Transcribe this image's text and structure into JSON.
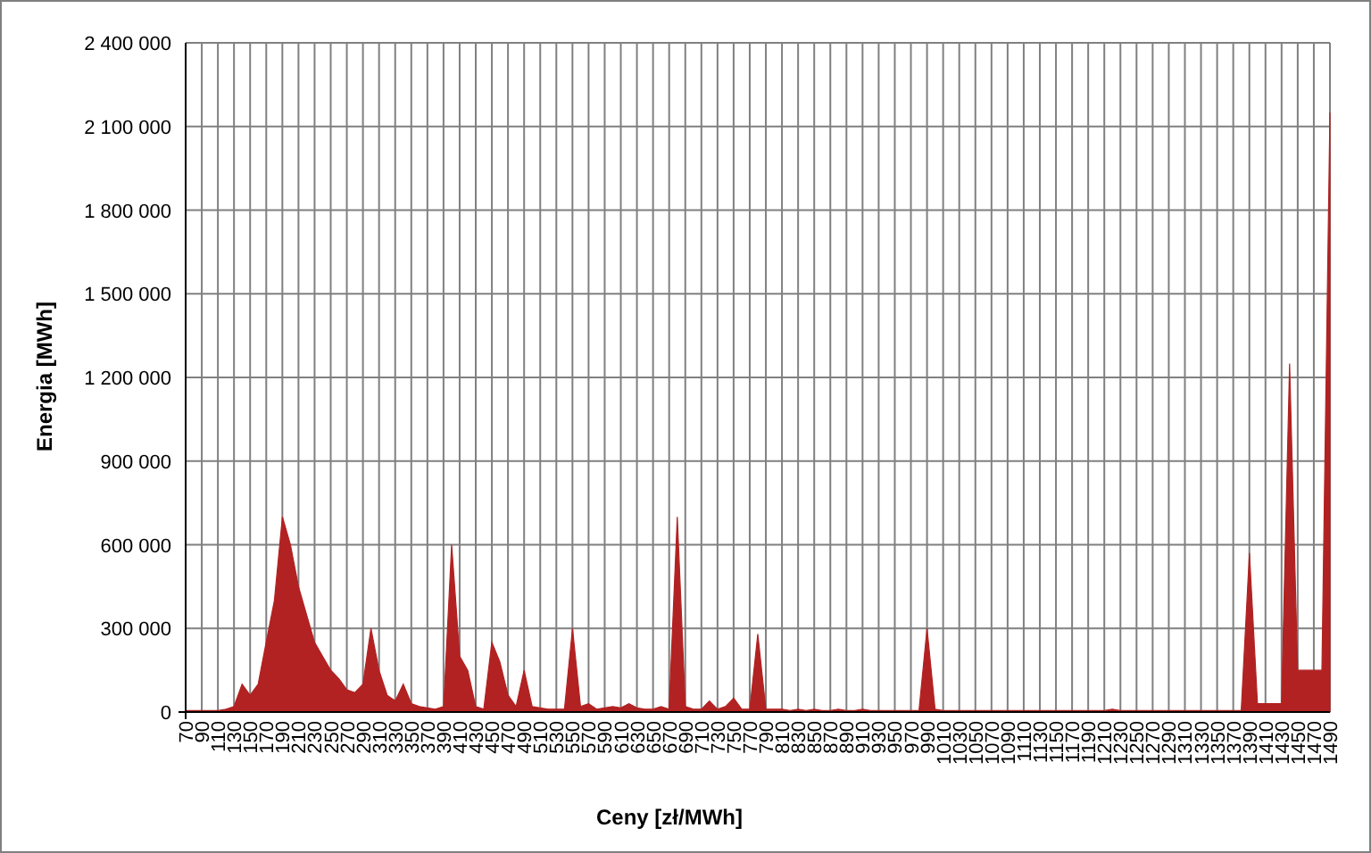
{
  "chart": {
    "chart_data": {
      "type": "area",
      "xlabel": "Ceny [zł/MWh]",
      "ylabel": "Energia [MWh]",
      "x": [
        70,
        80,
        90,
        100,
        110,
        120,
        130,
        140,
        150,
        160,
        170,
        180,
        190,
        200,
        210,
        220,
        230,
        240,
        250,
        260,
        270,
        280,
        290,
        300,
        310,
        320,
        330,
        340,
        350,
        360,
        370,
        380,
        390,
        400,
        410,
        420,
        430,
        440,
        450,
        460,
        470,
        480,
        490,
        500,
        510,
        520,
        530,
        540,
        550,
        560,
        570,
        580,
        590,
        600,
        610,
        620,
        630,
        640,
        650,
        660,
        670,
        680,
        690,
        700,
        710,
        720,
        730,
        740,
        750,
        760,
        770,
        780,
        790,
        800,
        810,
        820,
        830,
        840,
        850,
        860,
        870,
        880,
        890,
        900,
        910,
        920,
        930,
        940,
        950,
        960,
        970,
        980,
        990,
        1000,
        1010,
        1020,
        1030,
        1040,
        1050,
        1060,
        1070,
        1080,
        1090,
        1100,
        1110,
        1120,
        1130,
        1140,
        1150,
        1160,
        1170,
        1180,
        1190,
        1200,
        1210,
        1220,
        1230,
        1240,
        1250,
        1260,
        1270,
        1280,
        1290,
        1300,
        1310,
        1320,
        1330,
        1340,
        1350,
        1360,
        1370,
        1380,
        1390,
        1400,
        1410,
        1420,
        1430,
        1440,
        1450,
        1460,
        1470,
        1480,
        1490
      ],
      "grid": true,
      "series": [
        {
          "color": "#b22222",
          "values": [
            5000,
            5000,
            5000,
            5000,
            5000,
            10000,
            20000,
            100000,
            60000,
            100000,
            250000,
            400000,
            700000,
            600000,
            450000,
            350000,
            250000,
            200000,
            150000,
            120000,
            80000,
            70000,
            100000,
            300000,
            150000,
            60000,
            40000,
            100000,
            30000,
            20000,
            15000,
            10000,
            20000,
            600000,
            200000,
            150000,
            20000,
            10000,
            250000,
            180000,
            60000,
            20000,
            150000,
            20000,
            15000,
            10000,
            10000,
            10000,
            300000,
            20000,
            30000,
            10000,
            15000,
            20000,
            15000,
            30000,
            15000,
            10000,
            10000,
            20000,
            10000,
            700000,
            20000,
            10000,
            10000,
            40000,
            10000,
            20000,
            50000,
            10000,
            10000,
            280000,
            10000,
            10000,
            10000,
            5000,
            10000,
            5000,
            10000,
            5000,
            5000,
            10000,
            5000,
            5000,
            10000,
            5000,
            5000,
            5000,
            5000,
            5000,
            5000,
            5000,
            300000,
            10000,
            5000,
            5000,
            5000,
            5000,
            5000,
            5000,
            5000,
            5000,
            5000,
            5000,
            5000,
            5000,
            5000,
            5000,
            5000,
            5000,
            5000,
            5000,
            5000,
            5000,
            5000,
            10000,
            5000,
            5000,
            5000,
            5000,
            5000,
            5000,
            5000,
            5000,
            5000,
            5000,
            5000,
            5000,
            5000,
            5000,
            5000,
            5000,
            570000,
            30000,
            30000,
            30000,
            30000,
            1250000,
            150000,
            150000,
            150000,
            150000,
            2150000
          ]
        }
      ],
      "xlim": [
        70,
        1490
      ],
      "ylim": [
        0,
        2400000
      ],
      "xticks": [
        70,
        90,
        110,
        130,
        150,
        170,
        190,
        210,
        230,
        250,
        270,
        290,
        310,
        330,
        350,
        370,
        390,
        410,
        430,
        450,
        470,
        490,
        510,
        530,
        550,
        570,
        590,
        610,
        630,
        650,
        670,
        690,
        710,
        730,
        750,
        770,
        790,
        810,
        830,
        850,
        870,
        890,
        910,
        930,
        950,
        970,
        990,
        1010,
        1030,
        1050,
        1070,
        1090,
        1110,
        1130,
        1150,
        1170,
        1190,
        1210,
        1230,
        1250,
        1270,
        1290,
        1310,
        1330,
        1350,
        1370,
        1390,
        1410,
        1430,
        1450,
        1470,
        1490
      ],
      "yticks": [
        {
          "value": 0,
          "label": "0"
        },
        {
          "value": 300000,
          "label": "300 000"
        },
        {
          "value": 600000,
          "label": "600 000"
        },
        {
          "value": 900000,
          "label": "900 000"
        },
        {
          "value": 1200000,
          "label": "1 200 000"
        },
        {
          "value": 1500000,
          "label": "1 500 000"
        },
        {
          "value": 1800000,
          "label": "1 800 000"
        },
        {
          "value": 2100000,
          "label": "2 100 000"
        },
        {
          "value": 2400000,
          "label": "2 400 000"
        }
      ]
    }
  }
}
